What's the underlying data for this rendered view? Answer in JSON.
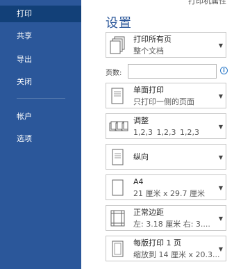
{
  "nav": {
    "items": [
      {
        "label": "打印",
        "active": true
      },
      {
        "label": "共享",
        "active": false
      },
      {
        "label": "导出",
        "active": false
      },
      {
        "label": "关闭",
        "active": false
      },
      {
        "label": "帐户",
        "active": false
      },
      {
        "label": "选项",
        "active": false
      }
    ]
  },
  "header": {
    "top_cut_text": "打印机属性",
    "title": "设置"
  },
  "settings": {
    "print_range": {
      "main": "打印所有页",
      "sub": "整个文档"
    },
    "pages": {
      "label": "页数:",
      "value": "",
      "info_icon": "info-icon"
    },
    "sides": {
      "main": "单面打印",
      "sub": "只打印一侧的页面"
    },
    "collate": {
      "main": "调整",
      "sub": "1,2,3    1,2,3    1,2,3"
    },
    "orientation": {
      "main": "纵向"
    },
    "paper": {
      "main": "A4",
      "sub": "21 厘米 x 29.7 厘米"
    },
    "margins": {
      "main": "正常边距",
      "sub": "左: 3.18 厘米    右: 3...."
    },
    "per_sheet": {
      "main": "每版打印 1 页",
      "sub": "缩放到 14 厘米 x 20.3..."
    }
  },
  "colors": {
    "nav_bg": "#2b579a",
    "nav_active": "#124078",
    "accent": "#2b579a"
  }
}
